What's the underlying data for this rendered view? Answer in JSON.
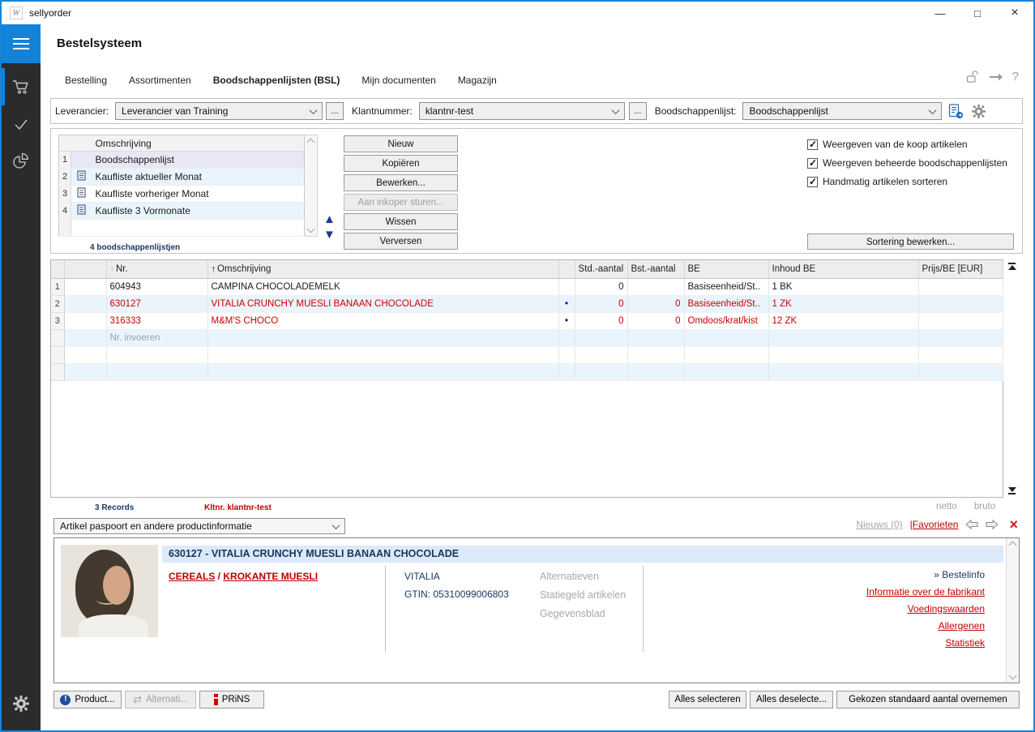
{
  "window": {
    "title": "sellyorder",
    "minimize": "—",
    "maximize": "□",
    "close": "×"
  },
  "header": {
    "title": "Bestelsysteem"
  },
  "tabs": [
    {
      "label": "Bestelling"
    },
    {
      "label": "Assortimenten"
    },
    {
      "label": "Boodschappenlijsten (BSL)"
    },
    {
      "label": "Mijn documenten"
    },
    {
      "label": "Magazijn"
    }
  ],
  "filters": {
    "leverancier_label": "Leverancier:",
    "leverancier_value": "Leverancier van Training",
    "more": "...",
    "klantnummer_label": "Klantnummer:",
    "klantnummer_value": "klantnr-test",
    "boodschappenlijst_label": "Boodschappenlijst:",
    "boodschappenlijst_value": "Boodschappenlijst"
  },
  "lists": {
    "header": "Omschrijving",
    "rows": [
      {
        "num": "1",
        "label": "Boodschappenlijst"
      },
      {
        "num": "2",
        "label": "Kaufliste aktueller Monat"
      },
      {
        "num": "3",
        "label": "Kaufliste vorheriger Monat"
      },
      {
        "num": "4",
        "label": "Kaufliste 3 Vormonate"
      }
    ],
    "count": "4 boodschappenlijstjen",
    "buttons": {
      "nieuw": "Nieuw",
      "kopieren": "Kopiëren",
      "bewerken": "Bewerken...",
      "aan_inkoper": "Aan inkoper sturen...",
      "wissen": "Wissen",
      "verversen": "Verversen"
    },
    "checkboxes": [
      {
        "label": "Weergeven van de koop artikelen",
        "checked": true
      },
      {
        "label": "Weergeven beheerde boodschappenlijsten",
        "checked": true
      },
      {
        "label": "Handmatig artikelen sorteren",
        "checked": true
      }
    ],
    "sort_button": "Sortering bewerken..."
  },
  "articles": {
    "columns": {
      "nr": "Nr.",
      "omschrijving": "Omschrijving",
      "std": "Std.-aantal",
      "bst": "Bst.-aantal",
      "be": "BE",
      "inhoud": "Inhoud BE",
      "prijs": "Prijs/BE [EUR]"
    },
    "rows": [
      {
        "num": "1",
        "nr": "604943",
        "omschrijving": "CAMPINA CHOCOLADEMELK",
        "std": "0",
        "bst": "",
        "be": "Basiseenheid/St..",
        "inhoud": "1 BK",
        "prijs": ""
      },
      {
        "num": "2",
        "nr": "630127",
        "omschrijving": "VITALIA CRUNCHY MUESLI BANAAN CHOCOLADE",
        "std": "0",
        "bst": "0",
        "be": "Basiseenheid/St..",
        "inhoud": "1 ZK",
        "prijs": ""
      },
      {
        "num": "3",
        "nr": "316333",
        "omschrijving": "M&M'S CHOCO",
        "std": "0",
        "bst": "0",
        "be": "Omdoos/krat/kist",
        "inhoud": "12 ZK",
        "prijs": ""
      }
    ],
    "placeholder": "Nr. invoeren",
    "records": "3 Records",
    "kltnr": "Kltnr. klantnr-test",
    "netto": "netto",
    "bruto": "bruto"
  },
  "info": {
    "selector": "Artikel paspoort en andere productinformatie",
    "nieuws": "Nieuws (0)",
    "favorieten": "|Favorieten",
    "title": "630127 - VITALIA CRUNCHY MUESLI BANAAN CHOCOLADE",
    "cat1": "CEREALS",
    "sep": " / ",
    "cat2": "KROKANTE MUESLI",
    "brand": "VITALIA",
    "gtin": "GTIN: 05310099006803",
    "grey": [
      {
        "label": "Alternatieven"
      },
      {
        "label": "Statiegeld artikelen"
      },
      {
        "label": "Gegevensblad"
      }
    ],
    "bestelinfo": "» Bestelinfo",
    "links": [
      {
        "label": "Informatie over de fabrikant"
      },
      {
        "label": "Voedingswaarden"
      },
      {
        "label": "Allergenen"
      },
      {
        "label": "Statistiek"
      }
    ]
  },
  "bottom": {
    "product": "Product...",
    "alternatieven": "Alternati...",
    "prins": "PRiNS",
    "select_all": "Alles selecteren",
    "deselect_all": "Alles deselecte...",
    "take_std": "Gekozen standaard aantal overnemen"
  },
  "colors": {
    "accent": "#1283d8",
    "red": "#c00000",
    "navy": "#17375e",
    "row_alt": "#eaf4fc"
  }
}
